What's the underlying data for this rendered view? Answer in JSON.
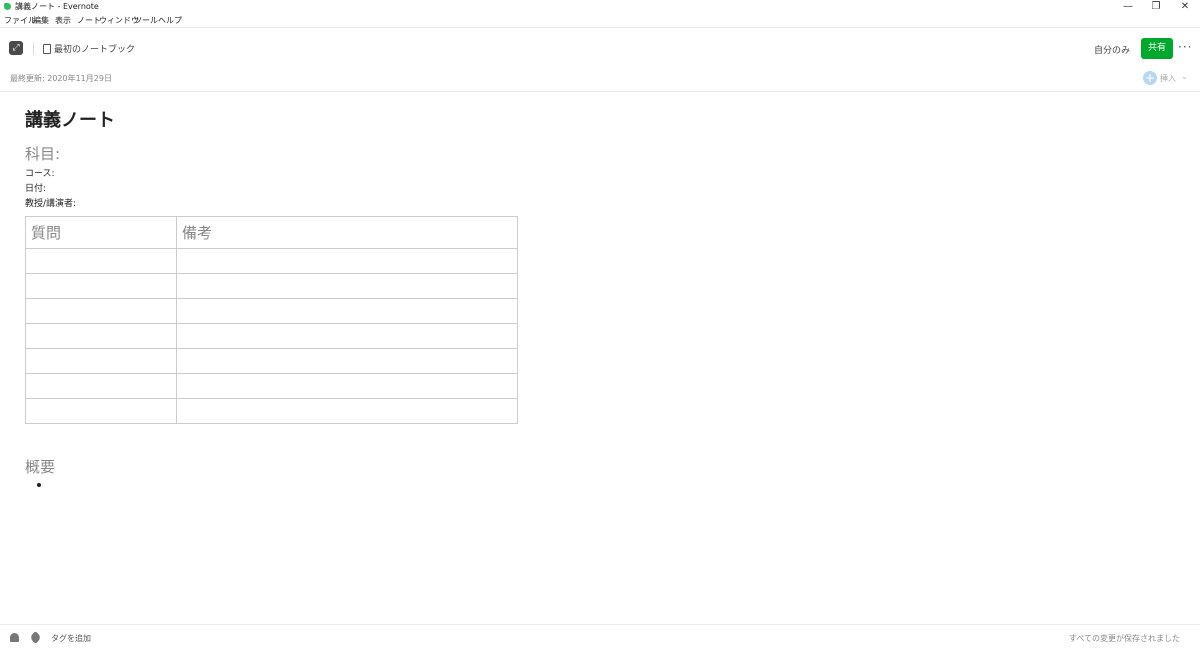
{
  "window": {
    "title": "講義ノート - Evernote",
    "controls": {
      "minimize": "—",
      "restore": "❐",
      "close": "✕"
    }
  },
  "menu": [
    "ファイル",
    "編集",
    "表示",
    "ノート",
    "ウィンドウ",
    "ツール",
    "ヘルプ"
  ],
  "toolbar": {
    "expand_icon": "expand-icon",
    "notebook_name": "最初のノートブック",
    "share_scope": "自分のみ",
    "share_label": "共有",
    "more_label": "···"
  },
  "meta": {
    "last_updated": "最終更新: 2020年11月29日",
    "insert_label": "挿入",
    "insert_symbol": "+",
    "insert_chevron": "⌄"
  },
  "note": {
    "title": "講義ノート",
    "subject": "科目:",
    "fields": [
      "コース:",
      "日付:",
      "教授/講演者:"
    ],
    "table": {
      "headers": [
        "質問",
        "備考"
      ],
      "empty_rows": 7
    },
    "summary_heading": "概要"
  },
  "footer": {
    "add_tag": "タグを追加",
    "saved_status": "すべての変更が保存されました"
  },
  "colors": {
    "accent": "#00a82d",
    "logo": "#2dbe60",
    "insert_icon": "#b8d7f0"
  }
}
